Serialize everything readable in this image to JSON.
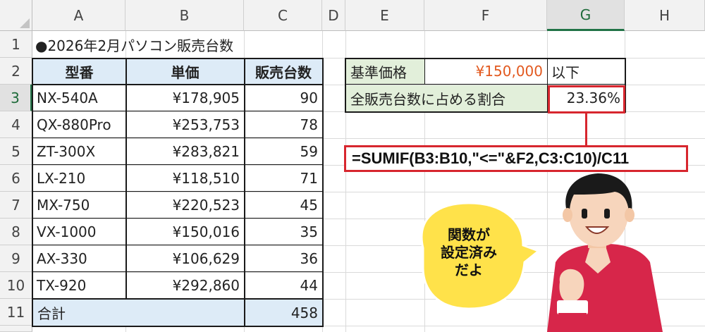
{
  "columns": [
    "A",
    "B",
    "C",
    "D",
    "E",
    "F",
    "G",
    "H"
  ],
  "rows": [
    "1",
    "2",
    "3",
    "4",
    "5",
    "6",
    "7",
    "8",
    "9",
    "10",
    "11"
  ],
  "title_cell": "●2026年2月パソコン販売台数",
  "table": {
    "headers": [
      "型番",
      "単価",
      "販売台数"
    ],
    "rows": [
      {
        "model": "NX-540A",
        "price": "¥178,905",
        "units": "90"
      },
      {
        "model": "QX-880Pro",
        "price": "¥253,753",
        "units": "78"
      },
      {
        "model": "ZT-300X",
        "price": "¥283,821",
        "units": "59"
      },
      {
        "model": "LX-210",
        "price": "¥118,510",
        "units": "71"
      },
      {
        "model": "MX-750",
        "price": "¥220,523",
        "units": "45"
      },
      {
        "model": "VX-1000",
        "price": "¥150,016",
        "units": "35"
      },
      {
        "model": "AX-330",
        "price": "¥106,629",
        "units": "36"
      },
      {
        "model": "TX-920",
        "price": "¥292,860",
        "units": "44"
      }
    ],
    "total_label": "合計",
    "total_value": "458"
  },
  "criteria": {
    "label": "基準価格",
    "value": "¥150,000",
    "suffix": "以下",
    "ratio_label": "全販売台数に占める割合",
    "ratio_value": "23.36%"
  },
  "formula": "=SUMIF(B3:B10,\"<=\"&F2,C3:C10)/C11",
  "bubble": {
    "line1": "関数が",
    "line2": "設定済み",
    "line3": "だよ"
  },
  "colors": {
    "accent_red": "#d7262e",
    "header_blue": "#ddebf7",
    "label_green": "#e2efda",
    "value_orange": "#e2591f",
    "bubble_yellow": "#ffe24a",
    "shirt_red": "#d7264a"
  }
}
